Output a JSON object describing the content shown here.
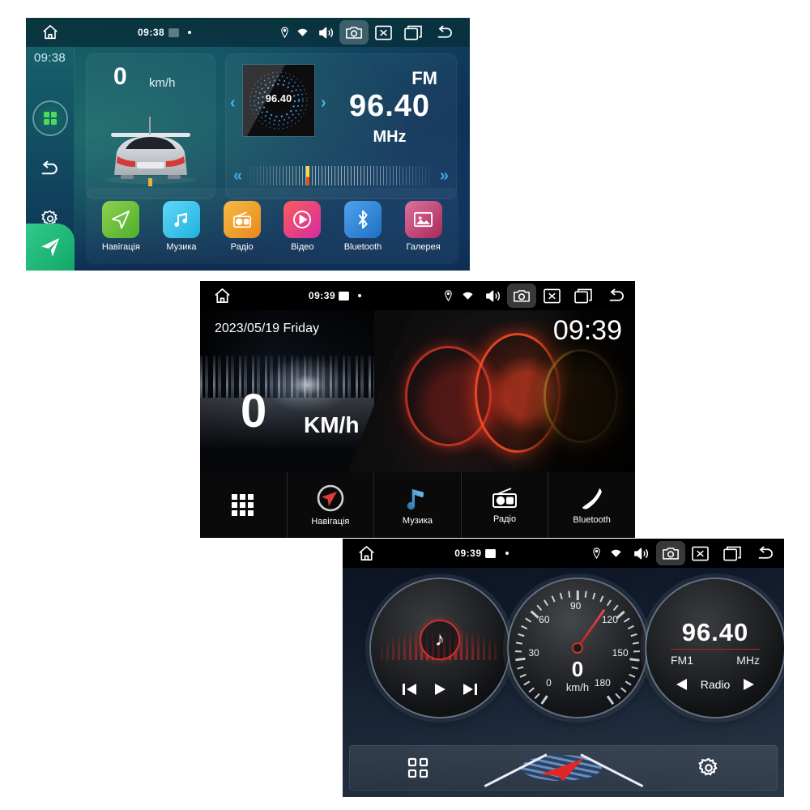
{
  "screenshots": [
    {
      "id": "panel-1-teal-home",
      "statusbar": {
        "clock": "09:38",
        "icons": [
          "home-icon",
          "image-icon",
          "dot-icon",
          "location-icon",
          "wifi-icon",
          "volume-icon",
          "camera-icon",
          "close-icon",
          "recents-icon",
          "back-icon"
        ]
      },
      "sidebar": {
        "clock": "09:38",
        "buttons": [
          "apps-grid-icon",
          "back-icon",
          "settings-gear-icon",
          "navigation-arrow-icon"
        ]
      },
      "speed": {
        "value": "0",
        "unit": "km/h"
      },
      "radio": {
        "band": "FM",
        "frequency": "96.40",
        "unit": "MHz",
        "art_label": "96.40",
        "prev": "‹",
        "next": "›",
        "seek_back": "«",
        "seek_fwd": "»"
      },
      "apps": [
        {
          "label": "Навігація",
          "icon": "navigation-arrow-icon",
          "color": "#77c043"
        },
        {
          "label": "Музика",
          "icon": "music-note-icon",
          "color": "#3fc6f0"
        },
        {
          "label": "Радіо",
          "icon": "radio-icon",
          "color": "#f0a028"
        },
        {
          "label": "Відео",
          "icon": "play-circle-icon",
          "color": "#e0338c"
        },
        {
          "label": "Bluetooth",
          "icon": "bluetooth-icon",
          "color": "#2f86d8"
        },
        {
          "label": "Галерея",
          "icon": "gallery-image-icon",
          "color": "#c3436f"
        }
      ]
    },
    {
      "id": "panel-2-black-home",
      "statusbar": {
        "clock": "09:39"
      },
      "hero": {
        "date": "2023/05/19 Friday",
        "time": "09:39",
        "speed": "0",
        "unit": "KM/h"
      },
      "dock": [
        {
          "label": "",
          "icon": "apps-grid-icon"
        },
        {
          "label": "Навігація",
          "icon": "compass-navigation-icon"
        },
        {
          "label": "Музика",
          "icon": "music-note-icon"
        },
        {
          "label": "Радіо",
          "icon": "radio-icon"
        },
        {
          "label": "Bluetooth",
          "icon": "phone-handset-icon"
        }
      ]
    },
    {
      "id": "panel-3-dials-home",
      "statusbar": {
        "clock": "09:39"
      },
      "music_dial": {
        "icon": "music-note-icon",
        "prev": "prev-track-icon",
        "play": "play-icon",
        "next": "next-track-icon"
      },
      "speed_dial": {
        "value": "0",
        "unit": "km/h",
        "ticks": [
          "0",
          "30",
          "60",
          "90",
          "120",
          "150",
          "180"
        ]
      },
      "radio_dial": {
        "frequency": "96.40",
        "band": "FM1",
        "unit": "MHz",
        "label": "Radio",
        "prev": "prev-station-icon",
        "next": "next-station-icon"
      },
      "dock": [
        {
          "icon": "apps-grid-icon"
        },
        {
          "icon": "navigation-logo-icon"
        },
        {
          "icon": "settings-gear-icon"
        }
      ]
    }
  ],
  "colors": {
    "teal": "#14575f",
    "accent_blue": "#3fa9e0",
    "red": "#c8342c",
    "green": "#29b473"
  }
}
